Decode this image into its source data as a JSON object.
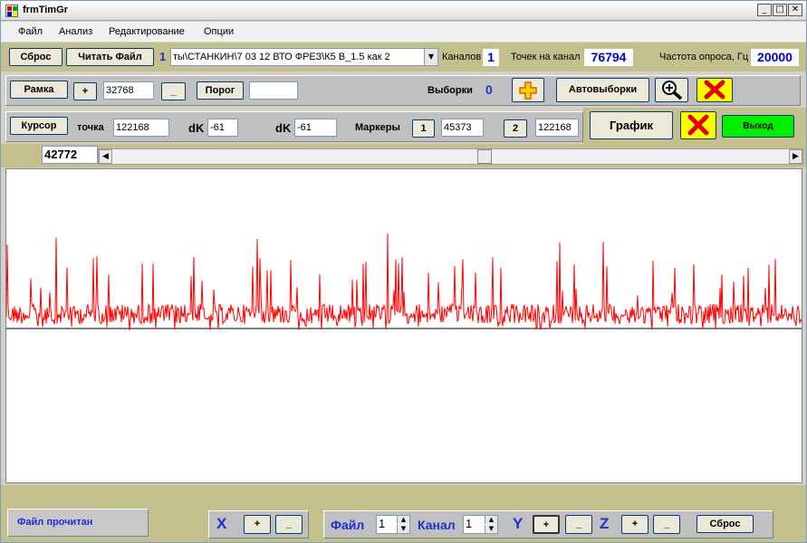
{
  "window": {
    "title": "frmTimGr",
    "min": "_",
    "max": "□",
    "close": "✕"
  },
  "menu": [
    "Файл",
    "Анализ",
    "Редактирование",
    "Опции"
  ],
  "row1": {
    "reset_label": "Сброс",
    "read_file_label": "Читать Файл",
    "file_index": "1",
    "file_path": "ты\\СТАНКИН\\7 03 12 ВТО ФРЕЗ\\К5  В_1.5  как 2",
    "channels_label": "Каналов",
    "channels_value": "1",
    "points_label": "Точек на канал",
    "points_value": "76794",
    "freq_label": "Частота опроса, Гц",
    "freq_value": "20000"
  },
  "row2": {
    "frame_label": "Рамка",
    "plus_label": "+",
    "frame_value": "32768",
    "minus_label": "_",
    "threshold_label": "Порог",
    "threshold_value": "",
    "samples_label": "Выборки",
    "samples_value": "0",
    "auto_samples_label": "Автовыборки"
  },
  "row3": {
    "cursor_label": "Курсор",
    "point_label": "точка",
    "point_value": "122168",
    "dk1_label": "dK",
    "dk1_value": "-61",
    "dk2_label": "dK",
    "dk2_value": "-61",
    "markers_label": "Маркеры",
    "marker1_label": "1",
    "marker1_value": "45373",
    "marker2_label": "2",
    "marker2_value": "122168",
    "graph_label": "График",
    "exit_label": "Выход"
  },
  "position_value": "42772",
  "scroll": {
    "left_arrow": "◀",
    "right_arrow": "▶",
    "position_fraction": 0.55
  },
  "status": {
    "message": "Файл прочитан",
    "x_label": "X",
    "x_plus": "+",
    "x_minus": "_",
    "file_label": "Файл",
    "file_value": "1",
    "channel_label": "Канал",
    "channel_value": "1",
    "y_label": "Y",
    "y_plus": "+",
    "y_minus": "_",
    "z_label": "Z",
    "z_plus": "+",
    "z_minus": "_",
    "reset_label": "Сброс"
  },
  "signal": {
    "color": "#ff0000",
    "baseline_color": "#000000"
  },
  "colors": {
    "exit_button": "#00ee00",
    "accent_value": "#0000cc",
    "label_blue": "#1c2fcf",
    "olive": "#c4c08e"
  }
}
